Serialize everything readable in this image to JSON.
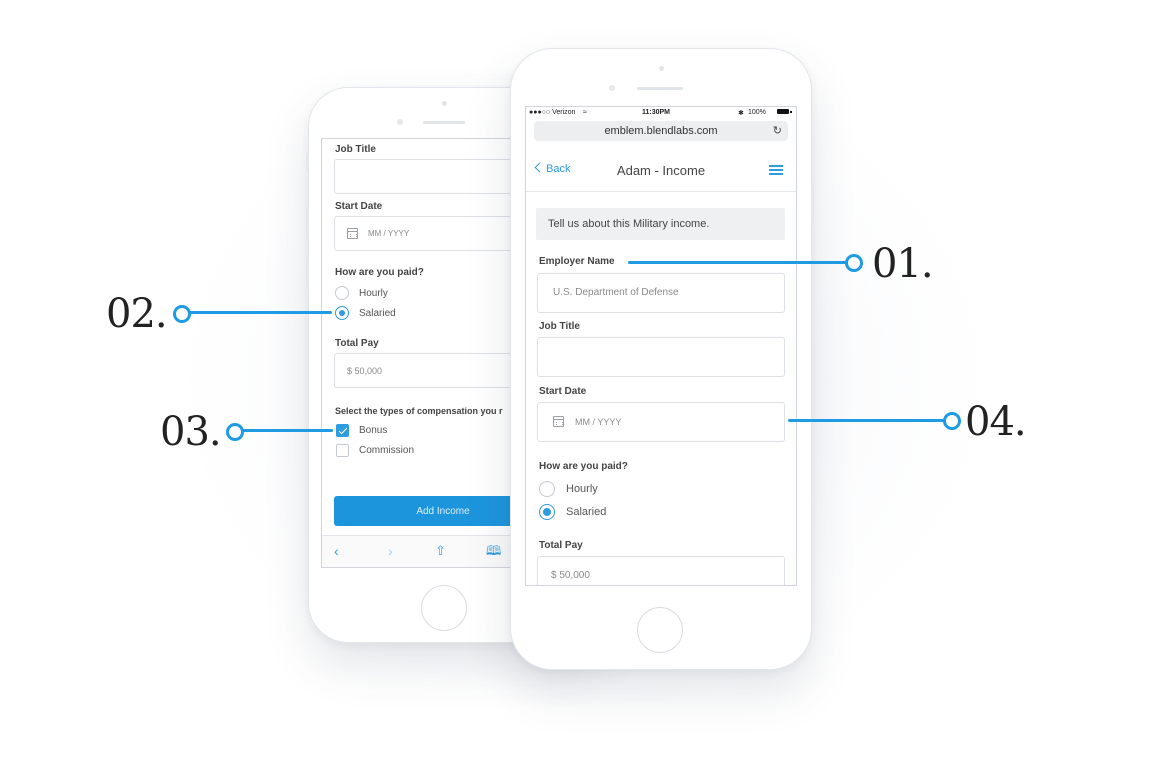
{
  "accent_color": "#1e9be3",
  "left_phone": {
    "form": {
      "job_title_label": "Job Title",
      "job_title_value": "",
      "start_date_label": "Start Date",
      "start_date_placeholder": "MM / YYYY",
      "pay_question": "How are you paid?",
      "pay_options": [
        "Hourly",
        "Salaried"
      ],
      "pay_selected": "Salaried",
      "total_pay_label": "Total Pay",
      "total_pay_value": "$ 50,000",
      "compensation_question": "Select the types of compensation you r",
      "compensation_options": [
        {
          "label": "Bonus",
          "checked": true
        },
        {
          "label": "Commission",
          "checked": false
        }
      ],
      "add_income_label": "Add Income"
    },
    "toolbar_icons": [
      "back-chevron-icon",
      "forward-chevron-icon",
      "share-icon",
      "bookmarks-icon"
    ]
  },
  "right_phone": {
    "status_bar": {
      "carrier": "●●●○○ Verizon",
      "time": "11:30PM",
      "battery": "100%"
    },
    "url": "emblem.blendlabs.com",
    "nav": {
      "back_label": "Back",
      "title": "Adam - Income"
    },
    "banner": "Tell us about this Military income.",
    "form": {
      "employer_label": "Employer Name",
      "employer_placeholder": "U.S. Department of Defense",
      "job_title_label": "Job Title",
      "job_title_value": "",
      "start_date_label": "Start Date",
      "start_date_placeholder": "MM / YYYY",
      "pay_question": "How are you paid?",
      "pay_options": [
        "Hourly",
        "Salaried"
      ],
      "pay_selected": "Salaried",
      "total_pay_label": "Total Pay",
      "total_pay_value": "$ 50,000"
    }
  },
  "callouts": [
    "01.",
    "02.",
    "03.",
    "04."
  ]
}
